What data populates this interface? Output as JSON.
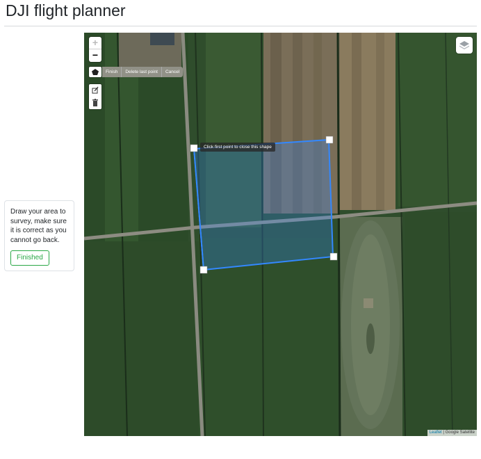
{
  "page": {
    "title": "DJI flight planner"
  },
  "sidebar": {
    "instructions": "Draw your area to survey, make sure it is correct as you cannot go back.",
    "finish_label": "Finished",
    "finish_color": "#28a745"
  },
  "map": {
    "zoom_in_label": "+",
    "zoom_out_label": "−",
    "draw": {
      "tool_icon": "polygon-icon",
      "actions": [
        "Finish",
        "Delete last point",
        "Cancel"
      ]
    },
    "edit_icons": [
      "edit-icon",
      "trash-icon"
    ],
    "layers_icon": "layers-icon",
    "tooltip": "Click first point to close this shape",
    "attribution": {
      "link": "Leaflet",
      "separator": " | ",
      "source": "Google Satellite"
    },
    "polygon_color": "#3388ff"
  }
}
